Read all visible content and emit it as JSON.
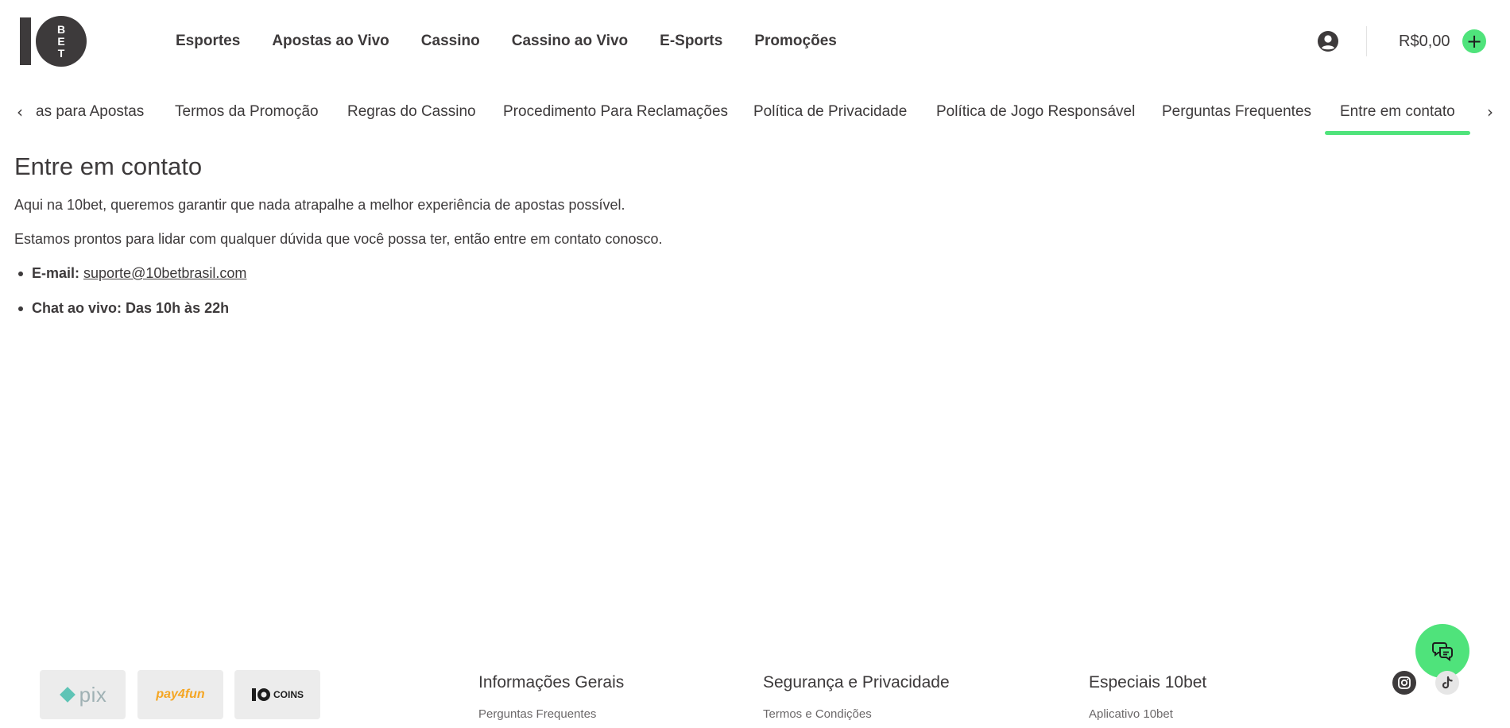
{
  "header": {
    "logo_alt": "10 BET",
    "nav": [
      {
        "label": "Esportes"
      },
      {
        "label": "Apostas ao Vivo"
      },
      {
        "label": "Cassino"
      },
      {
        "label": "Cassino ao Vivo"
      },
      {
        "label": "E-Sports"
      },
      {
        "label": "Promoções"
      }
    ],
    "balance": "R$0,00",
    "deposit_symbol": "+",
    "user_icon": "user-circle-icon"
  },
  "subnav": {
    "left_arrow": "‹",
    "right_arrow": "›",
    "tabs": [
      {
        "label": "as para Apostas"
      },
      {
        "label": "Termos da Promoção"
      },
      {
        "label": "Regras do Cassino"
      },
      {
        "label": "Procedimento Para Reclamações"
      },
      {
        "label": "Política de Privacidade"
      },
      {
        "label": "Política de Jogo Responsável"
      },
      {
        "label": "Perguntas Frequentes"
      },
      {
        "label": "Entre em contato"
      }
    ],
    "active_index": 7
  },
  "content": {
    "title": "Entre em contato",
    "paragraphs": [
      "Aqui na 10bet, queremos garantir que nada atrapalhe a melhor experiência de apostas possível.",
      "Estamos prontos para lidar com qualquer dúvida que você possa ter, então entre em contato conosco."
    ],
    "email_label": "E-mail:",
    "email_value": "suporte@10betbrasil.com",
    "chat_label": "Chat ao vivo: Das 10h às 22h"
  },
  "footer": {
    "payments": {
      "pix": "pix",
      "payfun": "pay4fun",
      "coins": "COINS"
    },
    "columns": [
      {
        "title": "Informações Gerais",
        "first_link": "Perguntas Frequentes"
      },
      {
        "title": "Segurança e Privacidade",
        "first_link": "Termos e Condições"
      },
      {
        "title": "Especiais 10bet",
        "first_link": "Aplicativo 10bet"
      }
    ],
    "social": [
      "instagram-icon",
      "tiktok-icon"
    ]
  },
  "colors": {
    "accent": "#4fe37b",
    "text": "#3d3a3b",
    "badge_bg": "#ececec"
  }
}
